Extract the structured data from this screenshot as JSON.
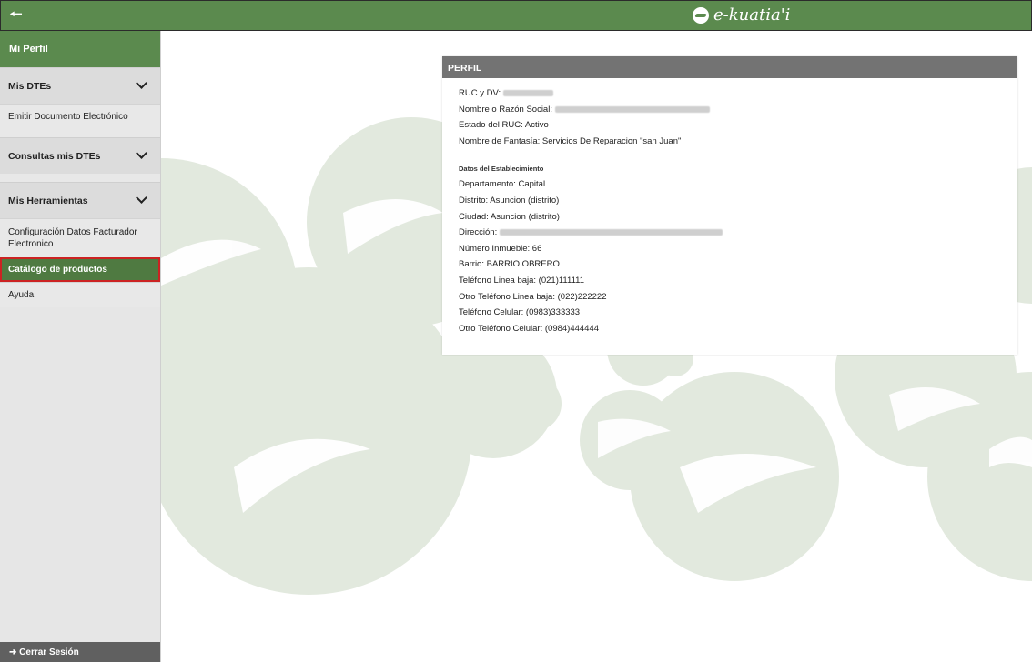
{
  "topbar": {
    "back_icon": "arrow-left-icon",
    "logo_text": "e-kuatia'i"
  },
  "sidebar": {
    "header": "Mi Perfil",
    "sections": [
      {
        "label": "Mis DTEs",
        "items": [
          "Emitir Documento Electrónico"
        ]
      },
      {
        "label": "Consultas mis DTEs",
        "items": []
      },
      {
        "label": "Mis Herramientas",
        "items": [
          "Configuración Datos Facturador Electronico",
          "Catálogo de productos",
          "Ayuda"
        ]
      }
    ],
    "active_item": "Catálogo de productos",
    "logout": "Cerrar Sesión"
  },
  "profile": {
    "title": "PERFIL",
    "ruc_label": "RUC y DV:",
    "name_label": "Nombre o Razón Social:",
    "estado": "Estado del RUC: Activo",
    "fantasia": "Nombre de Fantasía: Servicios De Reparacion \"san Juan\"",
    "establecimiento_title": "Datos del Establecimiento",
    "departamento": "Departamento: Capital",
    "distrito": "Distrito: Asuncion (distrito)",
    "ciudad": "Ciudad: Asuncion (distrito)",
    "direccion_label": "Dirección:",
    "numero": "Número Inmueble: 66",
    "barrio": "Barrio: BARRIO OBRERO",
    "tel1": "Teléfono Linea baja: (021)111111",
    "tel2": "Otro Teléfono Linea baja: (022)222222",
    "cel1": "Teléfono Celular: (0983)333333",
    "cel2": "Otro Teléfono Celular: (0984)444444"
  },
  "colors": {
    "brand_green": "#5b8a4e",
    "active_green": "#4f7a41",
    "active_border": "#cc2222",
    "header_gray": "#737373"
  }
}
